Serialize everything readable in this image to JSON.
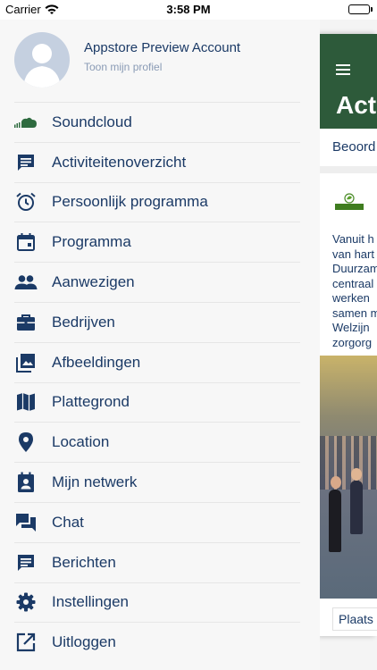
{
  "status_bar": {
    "carrier": "Carrier",
    "time": "3:58 PM"
  },
  "profile": {
    "name": "Appstore Preview Account",
    "link": "Toon mijn profiel"
  },
  "menu": {
    "items": [
      {
        "label": "Soundcloud",
        "icon": "soundcloud-icon"
      },
      {
        "label": "Activiteitenoverzicht",
        "icon": "message-icon"
      },
      {
        "label": "Persoonlijk programma",
        "icon": "alarm-clock-icon"
      },
      {
        "label": "Programma",
        "icon": "calendar-icon"
      },
      {
        "label": "Aanwezigen",
        "icon": "people-icon"
      },
      {
        "label": "Bedrijven",
        "icon": "briefcase-icon"
      },
      {
        "label": "Afbeeldingen",
        "icon": "images-icon"
      },
      {
        "label": "Plattegrond",
        "icon": "map-icon"
      },
      {
        "label": "Location",
        "icon": "location-pin-icon"
      },
      {
        "label": "Mijn netwerk",
        "icon": "contact-book-icon"
      },
      {
        "label": "Chat",
        "icon": "chat-icon"
      },
      {
        "label": "Berichten",
        "icon": "message-text-icon"
      },
      {
        "label": "Instellingen",
        "icon": "gear-icon"
      },
      {
        "label": "Uitloggen",
        "icon": "external-link-icon"
      }
    ]
  },
  "panel": {
    "title": "Act",
    "tab": "Beoord",
    "logo_text": "Green Deal",
    "text_lines": [
      "Vanuit h",
      "van hart",
      "Duurzam",
      "centraal",
      "werken",
      "samen m",
      "Welzijn",
      "zorgorg"
    ],
    "button": "Plaats"
  },
  "colors": {
    "primary_text": "#1b3a66",
    "header_green": "#2d5a3a",
    "soundcloud": "#2e6b3f"
  }
}
